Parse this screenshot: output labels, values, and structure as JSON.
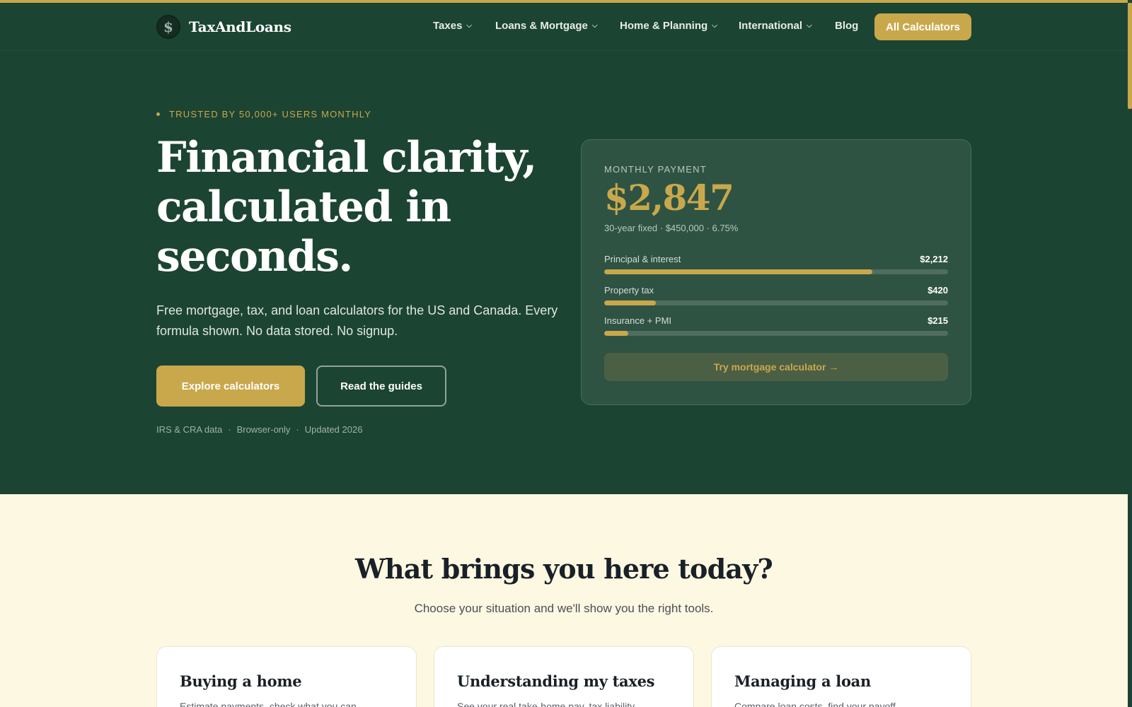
{
  "brand": {
    "name": "TaxAndLoans",
    "logo_glyph": "$",
    "colors": {
      "forest": "#1c4432",
      "gold": "#c9a84c",
      "cream": "#fdf8e1"
    }
  },
  "nav": {
    "items": [
      {
        "label": "Taxes",
        "has_dropdown": true
      },
      {
        "label": "Loans & Mortgage",
        "has_dropdown": true
      },
      {
        "label": "Home & Planning",
        "has_dropdown": true
      },
      {
        "label": "International",
        "has_dropdown": true
      },
      {
        "label": "Blog",
        "has_dropdown": false
      }
    ],
    "chevron_icon": "chevron-down-icon",
    "cta": "All Calculators"
  },
  "hero": {
    "eyebrow": "TRUSTED BY 50,000+ USERS MONTHLY",
    "headline": "Financial clarity, calculated in seconds.",
    "subtext": "Free mortgage, tax, and loan calculators for the US and Canada. Every formula shown. No data stored. No signup.",
    "primary_button": "Explore calculators",
    "secondary_button": "Read the guides",
    "meta": [
      "IRS & CRA data",
      "Browser-only",
      "Updated 2026"
    ],
    "meta_separator": "·"
  },
  "payment_card": {
    "label": "MONTHLY PAYMENT",
    "amount": "$2,847",
    "details": "30-year fixed · $450,000 · 6.75%",
    "breakdown": [
      {
        "label": "Principal & interest",
        "value": "$2,212",
        "fill_fraction": 0.78
      },
      {
        "label": "Property tax",
        "value": "$420",
        "fill_fraction": 0.15
      },
      {
        "label": "Insurance + PMI",
        "value": "$215",
        "fill_fraction": 0.07
      }
    ],
    "cta": "Try mortgage calculator →"
  },
  "situations": {
    "title": "What brings you here today?",
    "subtitle": "Choose your situation and we'll show you the right tools.",
    "cards": [
      {
        "title": "Buying a home",
        "desc": "Estimate payments, check what you can"
      },
      {
        "title": "Understanding my taxes",
        "desc": "See your real take-home pay, tax liability"
      },
      {
        "title": "Managing a loan",
        "desc": "Compare loan costs, find your payoff"
      }
    ]
  }
}
